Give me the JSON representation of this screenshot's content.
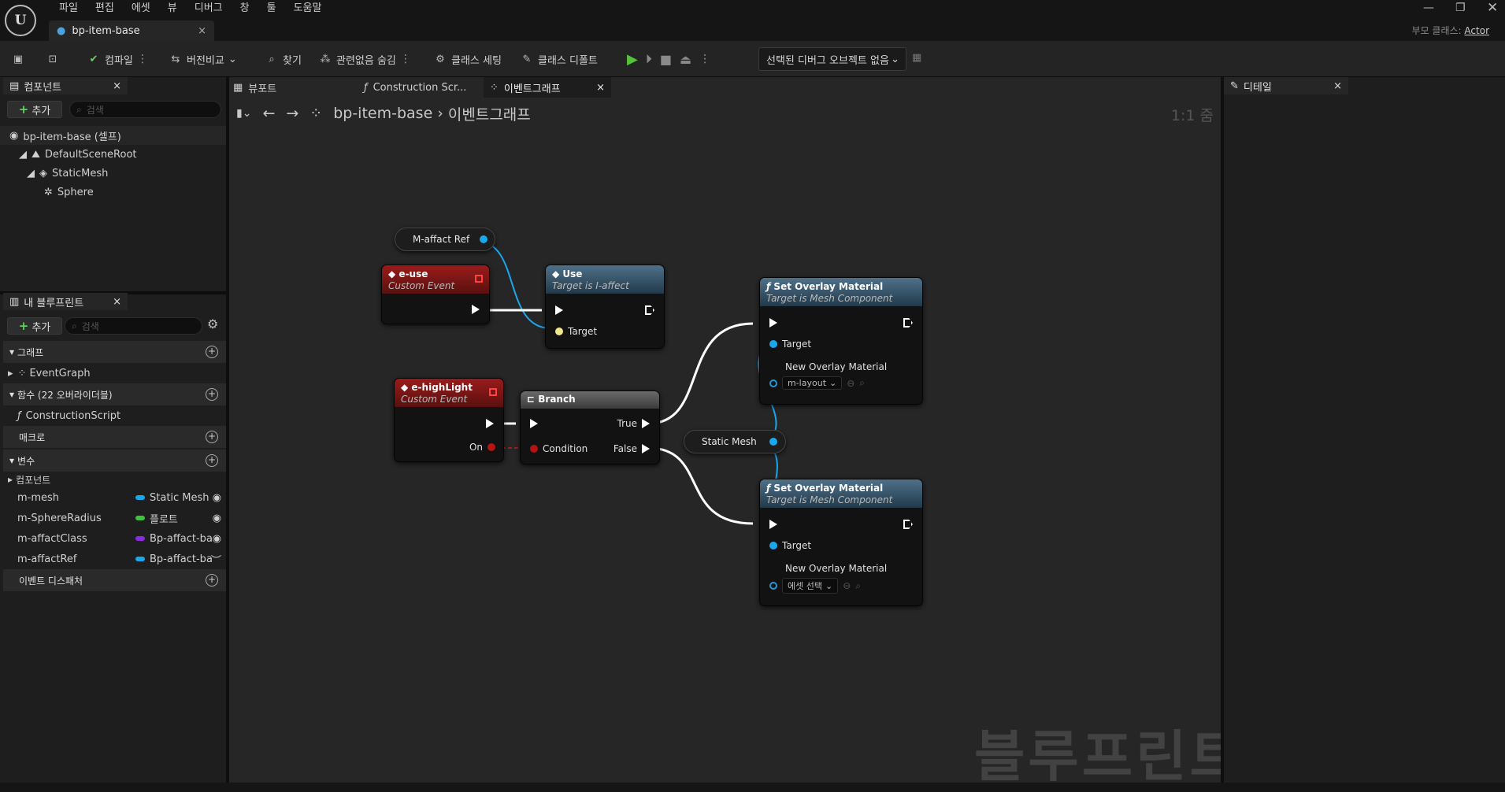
{
  "menu": [
    "파일",
    "편집",
    "에셋",
    "뷰",
    "디버그",
    "창",
    "툴",
    "도움말"
  ],
  "doc_tab": "bp-item-base",
  "parent_class_label": "부모 클래스:",
  "parent_class_value": "Actor",
  "toolbar": {
    "compile": "컴파일",
    "diff": "버전비교",
    "find": "찾기",
    "hide_unrelated": "관련없음 숨김",
    "class_settings": "클래스 세팅",
    "class_defaults": "클래스 디폴트",
    "debug_object": "선택된 디버그 오브젝트 없음"
  },
  "components_panel": {
    "title": "컴포넌트",
    "add": "추가",
    "search_placeholder": "검색",
    "tree": [
      "bp-item-base (셀프)",
      "DefaultSceneRoot",
      "StaticMesh",
      "Sphere"
    ]
  },
  "my_blueprint": {
    "title": "내 블루프린트",
    "add": "추가",
    "search_placeholder": "검색",
    "graphs_section": "그래프",
    "event_graph": "EventGraph",
    "functions_section": "함수 (22 오버라이더블)",
    "construction_script": "ConstructionScript",
    "macros_section": "매크로",
    "variables_section": "변수",
    "components_group": "컴포넌트",
    "variables": [
      {
        "name": "m-mesh",
        "type": "Static Mesh",
        "color": "#1aa7ec"
      },
      {
        "name": "m-SphereRadius",
        "type": "플로트",
        "color": "#40c040"
      },
      {
        "name": "m-affactClass",
        "type": "Bp-affact-ba",
        "color": "#8a2be2"
      },
      {
        "name": "m-affactRef",
        "type": "Bp-affact-ba",
        "color": "#1aa7ec"
      }
    ],
    "dispatchers_section": "이벤트 디스패처"
  },
  "graph_tabs": [
    "뷰포트",
    "Construction Scr...",
    "이벤트그래프"
  ],
  "breadcrumb": {
    "root": "bp-item-base",
    "current": "이벤트그래프"
  },
  "zoom": "1:1 줌",
  "details_tab": "디테일",
  "watermark": "블루프린트",
  "nodes": {
    "affact_ref": "M-affact Ref",
    "e_use": {
      "title": "e-use",
      "sub": "Custom Event"
    },
    "use": {
      "title": "Use",
      "sub": "Target is I-affect",
      "target": "Target"
    },
    "e_highlight": {
      "title": "e-highLight",
      "sub": "Custom Event",
      "on": "On"
    },
    "branch": {
      "title": "Branch",
      "true": "True",
      "false": "False",
      "condition": "Condition"
    },
    "static_mesh": "Static Mesh",
    "overlay1": {
      "title": "Set Overlay Material",
      "sub": "Target is Mesh Component",
      "target": "Target",
      "param": "New Overlay Material",
      "value": "m-layout"
    },
    "overlay2": {
      "title": "Set Overlay Material",
      "sub": "Target is Mesh Component",
      "target": "Target",
      "param": "New Overlay Material",
      "value": "에셋 선택"
    }
  }
}
